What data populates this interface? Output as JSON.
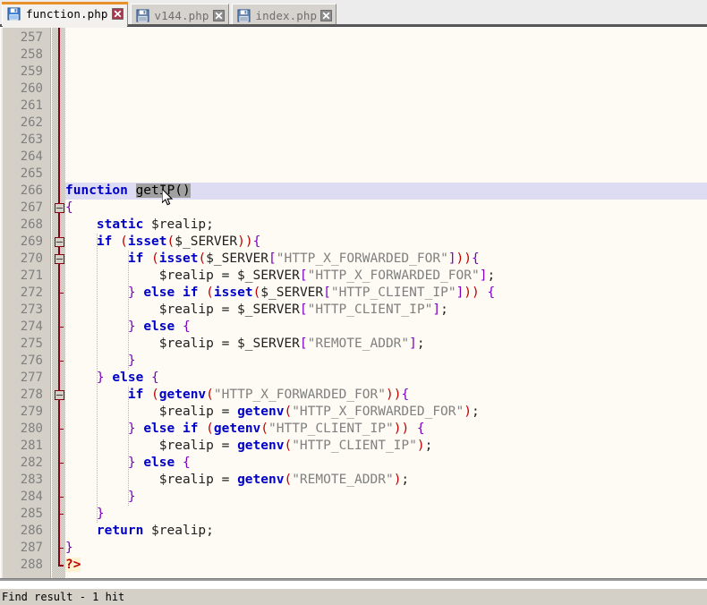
{
  "window": {
    "title": "function.php",
    "app": "Notepad++ / PHP source editor"
  },
  "tabbar": {
    "tabs": [
      {
        "label": "function.php",
        "active": true,
        "icon": "save-floppy-icon",
        "close_icon": "close-x-icon"
      },
      {
        "label": "v144.php",
        "active": false,
        "icon": "save-floppy-icon",
        "close_icon": "close-x-icon"
      },
      {
        "label": "index.php",
        "active": false,
        "icon": "save-floppy-icon",
        "close_icon": "close-x-icon"
      }
    ]
  },
  "editor": {
    "first_line": 257,
    "last_line": 288,
    "current_line": 266,
    "line_height": 19,
    "selection_text": "getIP()",
    "colors": {
      "background": "#fdfbf3",
      "gutter": "#d4d0c8",
      "current_line_highlight": "#dedcf2",
      "selection": "#a0a0a0",
      "keyword": "#0000c8",
      "string": "#808080",
      "bracket": "#8000c0",
      "paren": "#c00000",
      "brace": "#7b00c6",
      "php_tag_bg": "#fdf3d0",
      "fold_line": "#8b0012",
      "tab_active_accent": "#e8902a"
    },
    "lines": [
      {
        "n": 257,
        "tokens": []
      },
      {
        "n": 258,
        "tokens": []
      },
      {
        "n": 259,
        "tokens": []
      },
      {
        "n": 260,
        "tokens": []
      },
      {
        "n": 261,
        "tokens": []
      },
      {
        "n": 262,
        "tokens": []
      },
      {
        "n": 263,
        "tokens": []
      },
      {
        "n": 264,
        "tokens": []
      },
      {
        "n": 265,
        "tokens": []
      },
      {
        "n": 266,
        "tokens": [
          {
            "t": "function",
            "c": "kw"
          },
          {
            "t": " ",
            "c": "var"
          },
          {
            "t": "getIP",
            "c": "sel"
          },
          {
            "t": "()",
            "c": "sel par"
          }
        ]
      },
      {
        "n": 267,
        "tokens": [
          {
            "t": "{",
            "c": "brc"
          }
        ]
      },
      {
        "n": 268,
        "tokens": [
          {
            "t": "    ",
            "c": "var"
          },
          {
            "t": "static",
            "c": "kw"
          },
          {
            "t": " $realip",
            "c": "var"
          },
          {
            "t": ";",
            "c": "var"
          }
        ]
      },
      {
        "n": 269,
        "tokens": [
          {
            "t": "    ",
            "c": "var"
          },
          {
            "t": "if",
            "c": "kw"
          },
          {
            "t": " ",
            "c": "var"
          },
          {
            "t": "(",
            "c": "par"
          },
          {
            "t": "isset",
            "c": "kw"
          },
          {
            "t": "(",
            "c": "par"
          },
          {
            "t": "$_SERVER",
            "c": "var"
          },
          {
            "t": "))",
            "c": "par"
          },
          {
            "t": "{",
            "c": "brc"
          }
        ]
      },
      {
        "n": 270,
        "tokens": [
          {
            "t": "        ",
            "c": "var"
          },
          {
            "t": "if",
            "c": "kw"
          },
          {
            "t": " ",
            "c": "var"
          },
          {
            "t": "(",
            "c": "par"
          },
          {
            "t": "isset",
            "c": "kw"
          },
          {
            "t": "(",
            "c": "par"
          },
          {
            "t": "$_SERVER",
            "c": "var"
          },
          {
            "t": "[",
            "c": "brk"
          },
          {
            "t": "\"HTTP_X_FORWARDED_FOR\"",
            "c": "str"
          },
          {
            "t": "]",
            "c": "brk"
          },
          {
            "t": "))",
            "c": "par"
          },
          {
            "t": "{",
            "c": "brc"
          }
        ]
      },
      {
        "n": 271,
        "tokens": [
          {
            "t": "            $realip = $_SERVER",
            "c": "var"
          },
          {
            "t": "[",
            "c": "brk"
          },
          {
            "t": "\"HTTP_X_FORWARDED_FOR\"",
            "c": "str"
          },
          {
            "t": "]",
            "c": "brk"
          },
          {
            "t": ";",
            "c": "var"
          }
        ]
      },
      {
        "n": 272,
        "tokens": [
          {
            "t": "        ",
            "c": "var"
          },
          {
            "t": "}",
            "c": "brc"
          },
          {
            "t": " ",
            "c": "var"
          },
          {
            "t": "else",
            "c": "kw"
          },
          {
            "t": " ",
            "c": "var"
          },
          {
            "t": "if",
            "c": "kw"
          },
          {
            "t": " ",
            "c": "var"
          },
          {
            "t": "(",
            "c": "par"
          },
          {
            "t": "isset",
            "c": "kw"
          },
          {
            "t": "(",
            "c": "par"
          },
          {
            "t": "$_SERVER",
            "c": "var"
          },
          {
            "t": "[",
            "c": "brk"
          },
          {
            "t": "\"HTTP_CLIENT_IP\"",
            "c": "str"
          },
          {
            "t": "]",
            "c": "brk"
          },
          {
            "t": "))",
            "c": "par"
          },
          {
            "t": " ",
            "c": "var"
          },
          {
            "t": "{",
            "c": "brc"
          }
        ]
      },
      {
        "n": 273,
        "tokens": [
          {
            "t": "            $realip = $_SERVER",
            "c": "var"
          },
          {
            "t": "[",
            "c": "brk"
          },
          {
            "t": "\"HTTP_CLIENT_IP\"",
            "c": "str"
          },
          {
            "t": "]",
            "c": "brk"
          },
          {
            "t": ";",
            "c": "var"
          }
        ]
      },
      {
        "n": 274,
        "tokens": [
          {
            "t": "        ",
            "c": "var"
          },
          {
            "t": "}",
            "c": "brc"
          },
          {
            "t": " ",
            "c": "var"
          },
          {
            "t": "else",
            "c": "kw"
          },
          {
            "t": " ",
            "c": "var"
          },
          {
            "t": "{",
            "c": "brc"
          }
        ]
      },
      {
        "n": 275,
        "tokens": [
          {
            "t": "            $realip = $_SERVER",
            "c": "var"
          },
          {
            "t": "[",
            "c": "brk"
          },
          {
            "t": "\"REMOTE_ADDR\"",
            "c": "str"
          },
          {
            "t": "]",
            "c": "brk"
          },
          {
            "t": ";",
            "c": "var"
          }
        ]
      },
      {
        "n": 276,
        "tokens": [
          {
            "t": "        ",
            "c": "var"
          },
          {
            "t": "}",
            "c": "brc"
          }
        ]
      },
      {
        "n": 277,
        "tokens": [
          {
            "t": "    ",
            "c": "var"
          },
          {
            "t": "}",
            "c": "brc"
          },
          {
            "t": " ",
            "c": "var"
          },
          {
            "t": "else",
            "c": "kw"
          },
          {
            "t": " ",
            "c": "var"
          },
          {
            "t": "{",
            "c": "brc"
          }
        ]
      },
      {
        "n": 278,
        "tokens": [
          {
            "t": "        ",
            "c": "var"
          },
          {
            "t": "if",
            "c": "kw"
          },
          {
            "t": " ",
            "c": "var"
          },
          {
            "t": "(",
            "c": "par"
          },
          {
            "t": "getenv",
            "c": "kw"
          },
          {
            "t": "(",
            "c": "par"
          },
          {
            "t": "\"HTTP_X_FORWARDED_FOR\"",
            "c": "str"
          },
          {
            "t": "))",
            "c": "par"
          },
          {
            "t": "{",
            "c": "brc"
          }
        ]
      },
      {
        "n": 279,
        "tokens": [
          {
            "t": "            $realip = ",
            "c": "var"
          },
          {
            "t": "getenv",
            "c": "kw"
          },
          {
            "t": "(",
            "c": "par"
          },
          {
            "t": "\"HTTP_X_FORWARDED_FOR\"",
            "c": "str"
          },
          {
            "t": ")",
            "c": "par"
          },
          {
            "t": ";",
            "c": "var"
          }
        ]
      },
      {
        "n": 280,
        "tokens": [
          {
            "t": "        ",
            "c": "var"
          },
          {
            "t": "}",
            "c": "brc"
          },
          {
            "t": " ",
            "c": "var"
          },
          {
            "t": "else",
            "c": "kw"
          },
          {
            "t": " ",
            "c": "var"
          },
          {
            "t": "if",
            "c": "kw"
          },
          {
            "t": " ",
            "c": "var"
          },
          {
            "t": "(",
            "c": "par"
          },
          {
            "t": "getenv",
            "c": "kw"
          },
          {
            "t": "(",
            "c": "par"
          },
          {
            "t": "\"HTTP_CLIENT_IP\"",
            "c": "str"
          },
          {
            "t": "))",
            "c": "par"
          },
          {
            "t": " ",
            "c": "var"
          },
          {
            "t": "{",
            "c": "brc"
          }
        ]
      },
      {
        "n": 281,
        "tokens": [
          {
            "t": "            $realip = ",
            "c": "var"
          },
          {
            "t": "getenv",
            "c": "kw"
          },
          {
            "t": "(",
            "c": "par"
          },
          {
            "t": "\"HTTP_CLIENT_IP\"",
            "c": "str"
          },
          {
            "t": ")",
            "c": "par"
          },
          {
            "t": ";",
            "c": "var"
          }
        ]
      },
      {
        "n": 282,
        "tokens": [
          {
            "t": "        ",
            "c": "var"
          },
          {
            "t": "}",
            "c": "brc"
          },
          {
            "t": " ",
            "c": "var"
          },
          {
            "t": "else",
            "c": "kw"
          },
          {
            "t": " ",
            "c": "var"
          },
          {
            "t": "{",
            "c": "brc"
          }
        ]
      },
      {
        "n": 283,
        "tokens": [
          {
            "t": "            $realip = ",
            "c": "var"
          },
          {
            "t": "getenv",
            "c": "kw"
          },
          {
            "t": "(",
            "c": "par"
          },
          {
            "t": "\"REMOTE_ADDR\"",
            "c": "str"
          },
          {
            "t": ")",
            "c": "par"
          },
          {
            "t": ";",
            "c": "var"
          }
        ]
      },
      {
        "n": 284,
        "tokens": [
          {
            "t": "        ",
            "c": "var"
          },
          {
            "t": "}",
            "c": "brc"
          }
        ]
      },
      {
        "n": 285,
        "tokens": [
          {
            "t": "    ",
            "c": "var"
          },
          {
            "t": "}",
            "c": "brc"
          }
        ]
      },
      {
        "n": 286,
        "tokens": [
          {
            "t": "    ",
            "c": "var"
          },
          {
            "t": "return",
            "c": "kw"
          },
          {
            "t": " $realip",
            "c": "var"
          },
          {
            "t": ";",
            "c": "var"
          }
        ]
      },
      {
        "n": 287,
        "tokens": [
          {
            "t": "}",
            "c": "brc"
          }
        ]
      },
      {
        "n": 288,
        "tokens": [
          {
            "t": "?>",
            "c": "php"
          }
        ]
      }
    ],
    "fold_boxes": [
      267,
      269,
      270,
      278
    ],
    "fold_ticks": [
      272,
      274,
      276,
      280,
      282,
      284,
      285,
      287
    ],
    "fold_end": 288
  },
  "statusbar": {
    "message": "Find result - 1 hit"
  }
}
